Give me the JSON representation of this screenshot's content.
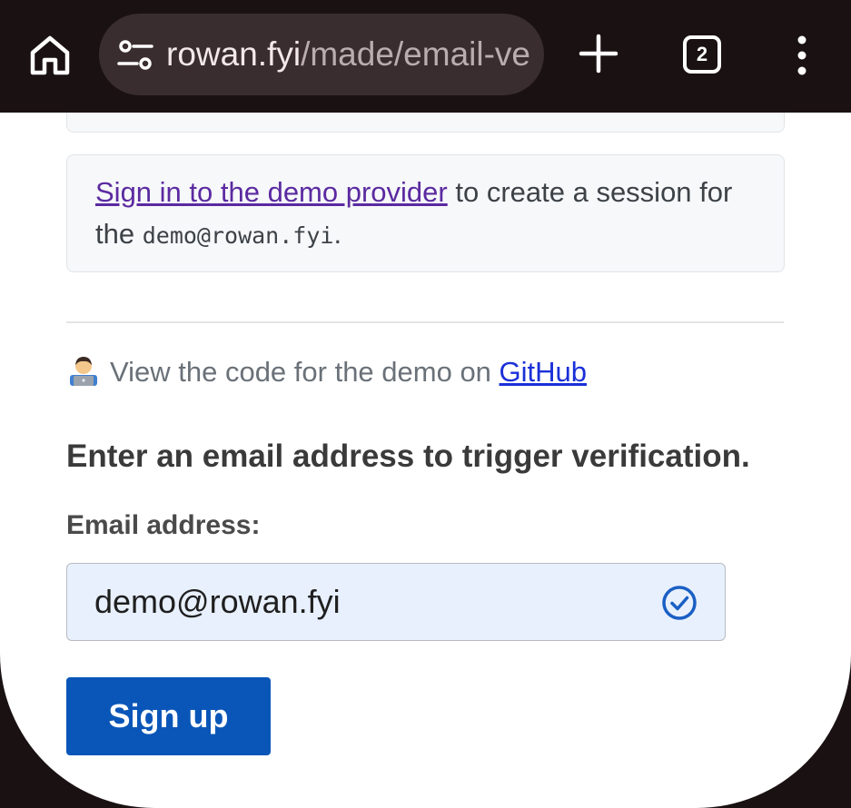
{
  "browser": {
    "url_host": "rowan.fyi",
    "url_path": "/made/email-ve",
    "tab_count": "2",
    "icons": [
      "home-icon",
      "tune-icon",
      "plus-icon",
      "tabs-icon",
      "more-vert-icon"
    ]
  },
  "notice": {
    "link_text": "Sign in to the demo provider",
    "text_after_link": " to create a session for the ",
    "email_code": "demo@rowan.fyi",
    "period": "."
  },
  "code_line": {
    "emoji_icon": "technologist-icon",
    "text": "View the code for the demo on ",
    "link": "GitHub"
  },
  "form": {
    "heading": "Enter an email address to trigger verification.",
    "email_label": "Email address:",
    "email_value": "demo@rowan.fyi",
    "submit_label": "Sign up"
  },
  "colors": {
    "toolbar_bg": "#1a1112",
    "url_pill_bg": "#3a2d30",
    "link_visited": "#5b2aa0",
    "link": "#1a2fd8",
    "button_bg": "#0a56b8",
    "input_bg": "#e8f0fe"
  }
}
